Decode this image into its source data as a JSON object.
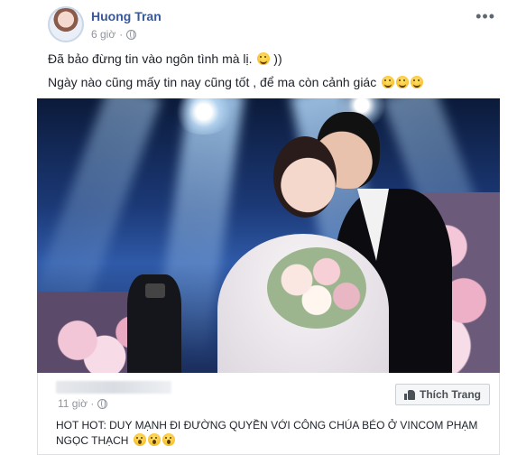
{
  "post": {
    "author": "Huong Tran",
    "time": "6 giờ",
    "more_label": "•••",
    "line1": "Đã bảo đừng tin vào ngôn tình mà lị.",
    "line1_suffix": "))",
    "line2": "Ngày nào cũng mấy tin nay cũng tốt , để ma còn cảnh giác"
  },
  "shared": {
    "time": "11 giờ ·",
    "like_button": "Thích Trang",
    "text": "HOT HOT: DUY MẠNH ĐI ĐƯỜNG QUYỀN VỚI CÔNG CHÚA BÉO Ở VINCOM PHẠM NGỌC THẠCH"
  },
  "icons": {
    "globe": "globe-icon",
    "more": "more-horizontal-icon",
    "thumb": "thumbs-up-icon",
    "smile": "smile-emoji",
    "grin": "grin-emoji",
    "shock": "shocked-emoji"
  },
  "colors": {
    "author": "#385898",
    "meta": "#90949c",
    "border": "#dddfe2"
  }
}
